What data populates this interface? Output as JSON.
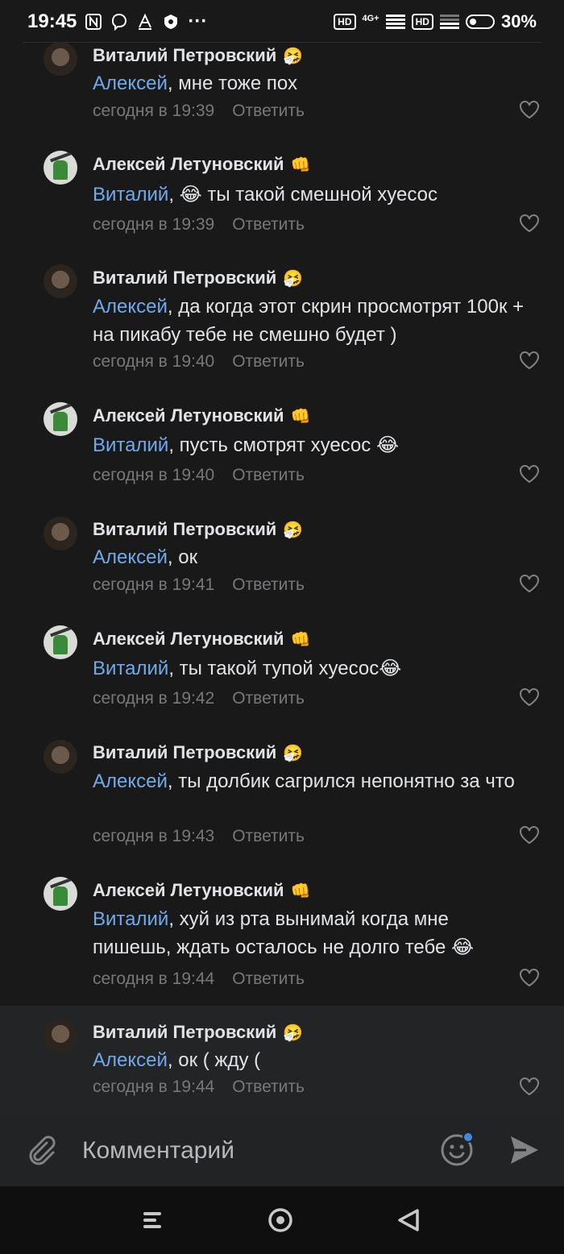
{
  "status_bar": {
    "time": "19:45",
    "network_label": "4G+",
    "hd_label_1": "HD",
    "hd_label_2": "HD",
    "battery_percent": "30%",
    "more_label": "···"
  },
  "comments": [
    {
      "author": "Виталий Петровский",
      "badge": "🤧",
      "mention": "Алексей",
      "text": ", мне тоже пох",
      "time": "сегодня в 19:39",
      "reply": "Ответить",
      "avatar": "dark"
    },
    {
      "author": "Алексей Летуновский",
      "badge": "👊",
      "mention": "Виталий",
      "text": ", 😂 ты такой смешной хуесос",
      "time": "сегодня в 19:39",
      "reply": "Ответить",
      "avatar": "light"
    },
    {
      "author": "Виталий Петровский",
      "badge": "🤧",
      "mention": "Алексей",
      "text": ", да когда этот скрин просмотрят 100к + на пикабу тебе не смешно будет )",
      "time": "сегодня в 19:40",
      "reply": "Ответить",
      "avatar": "dark"
    },
    {
      "author": "Алексей Летуновский",
      "badge": "👊",
      "mention": "Виталий",
      "text": ", пусть смотрят хуесос 😂",
      "time": "сегодня в 19:40",
      "reply": "Ответить",
      "avatar": "light"
    },
    {
      "author": "Виталий Петровский",
      "badge": "🤧",
      "mention": "Алексей",
      "text": ", ок",
      "time": "сегодня в 19:41",
      "reply": "Ответить",
      "avatar": "dark"
    },
    {
      "author": "Алексей Летуновский",
      "badge": "👊",
      "mention": "Виталий",
      "text": ", ты такой тупой хуесос😂",
      "time": "сегодня в 19:42",
      "reply": "Ответить",
      "avatar": "light"
    },
    {
      "author": "Виталий Петровский",
      "badge": "🤧",
      "mention": "Алексей",
      "text": ", ты долбик сагрился непонятно за что",
      "time": "сегодня в 19:43",
      "reply": "Ответить",
      "avatar": "dark"
    },
    {
      "author": "Алексей Летуновский",
      "badge": "👊",
      "mention": "Виталий",
      "text": ", хуй из рта вынимай когда мне пишешь, ждать осталось не долго тебе 😂",
      "time": "сегодня в 19:44",
      "reply": "Ответить",
      "avatar": "light"
    },
    {
      "author": "Виталий Петровский",
      "badge": "🤧",
      "mention": "Алексей",
      "text": ", ок ( жду (",
      "time": "сегодня в 19:44",
      "reply": "Ответить",
      "avatar": "dark"
    }
  ],
  "composer": {
    "placeholder": "Комментарий"
  },
  "colors": {
    "background": "#19191a",
    "mention": "#71aaeb",
    "meta": "#76787a",
    "accent_dot": "#3f8ae0"
  }
}
